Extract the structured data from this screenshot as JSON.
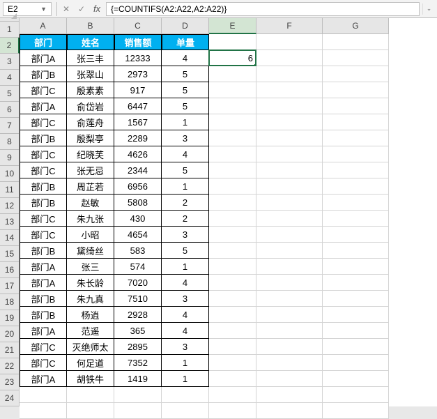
{
  "nameBox": "E2",
  "formula": "{=COUNTIFS(A2:A22,A2:A22)}",
  "columns": [
    "A",
    "B",
    "C",
    "D",
    "E",
    "F",
    "G"
  ],
  "selectedCell": {
    "col": "E",
    "row": 2,
    "value": "6"
  },
  "headers": {
    "A": "部门",
    "B": "姓名",
    "C": "销售额",
    "D": "单量"
  },
  "rows": [
    {
      "A": "部门A",
      "B": "张三丰",
      "C": "12333",
      "D": "4"
    },
    {
      "A": "部门B",
      "B": "张翠山",
      "C": "2973",
      "D": "5"
    },
    {
      "A": "部门C",
      "B": "殷素素",
      "C": "917",
      "D": "5"
    },
    {
      "A": "部门A",
      "B": "俞岱岩",
      "C": "6447",
      "D": "5"
    },
    {
      "A": "部门C",
      "B": "俞莲舟",
      "C": "1567",
      "D": "1"
    },
    {
      "A": "部门B",
      "B": "殷梨亭",
      "C": "2289",
      "D": "3"
    },
    {
      "A": "部门C",
      "B": "纪晓芙",
      "C": "4626",
      "D": "4"
    },
    {
      "A": "部门C",
      "B": "张无忌",
      "C": "2344",
      "D": "5"
    },
    {
      "A": "部门B",
      "B": "周芷若",
      "C": "6956",
      "D": "1"
    },
    {
      "A": "部门B",
      "B": "赵敏",
      "C": "5808",
      "D": "2"
    },
    {
      "A": "部门C",
      "B": "朱九张",
      "C": "430",
      "D": "2"
    },
    {
      "A": "部门C",
      "B": "小昭",
      "C": "4654",
      "D": "3"
    },
    {
      "A": "部门B",
      "B": "黛绮丝",
      "C": "583",
      "D": "5"
    },
    {
      "A": "部门A",
      "B": "张三",
      "C": "574",
      "D": "1"
    },
    {
      "A": "部门A",
      "B": "朱长龄",
      "C": "7020",
      "D": "4"
    },
    {
      "A": "部门B",
      "B": "朱九真",
      "C": "7510",
      "D": "3"
    },
    {
      "A": "部门B",
      "B": "杨逍",
      "C": "2928",
      "D": "4"
    },
    {
      "A": "部门A",
      "B": "范遥",
      "C": "365",
      "D": "4"
    },
    {
      "A": "部门C",
      "B": "灭绝师太",
      "C": "2895",
      "D": "3"
    },
    {
      "A": "部门C",
      "B": "何足道",
      "C": "7352",
      "D": "1"
    },
    {
      "A": "部门A",
      "B": "胡铁牛",
      "C": "1419",
      "D": "1"
    }
  ],
  "totalVisibleRows": 24
}
